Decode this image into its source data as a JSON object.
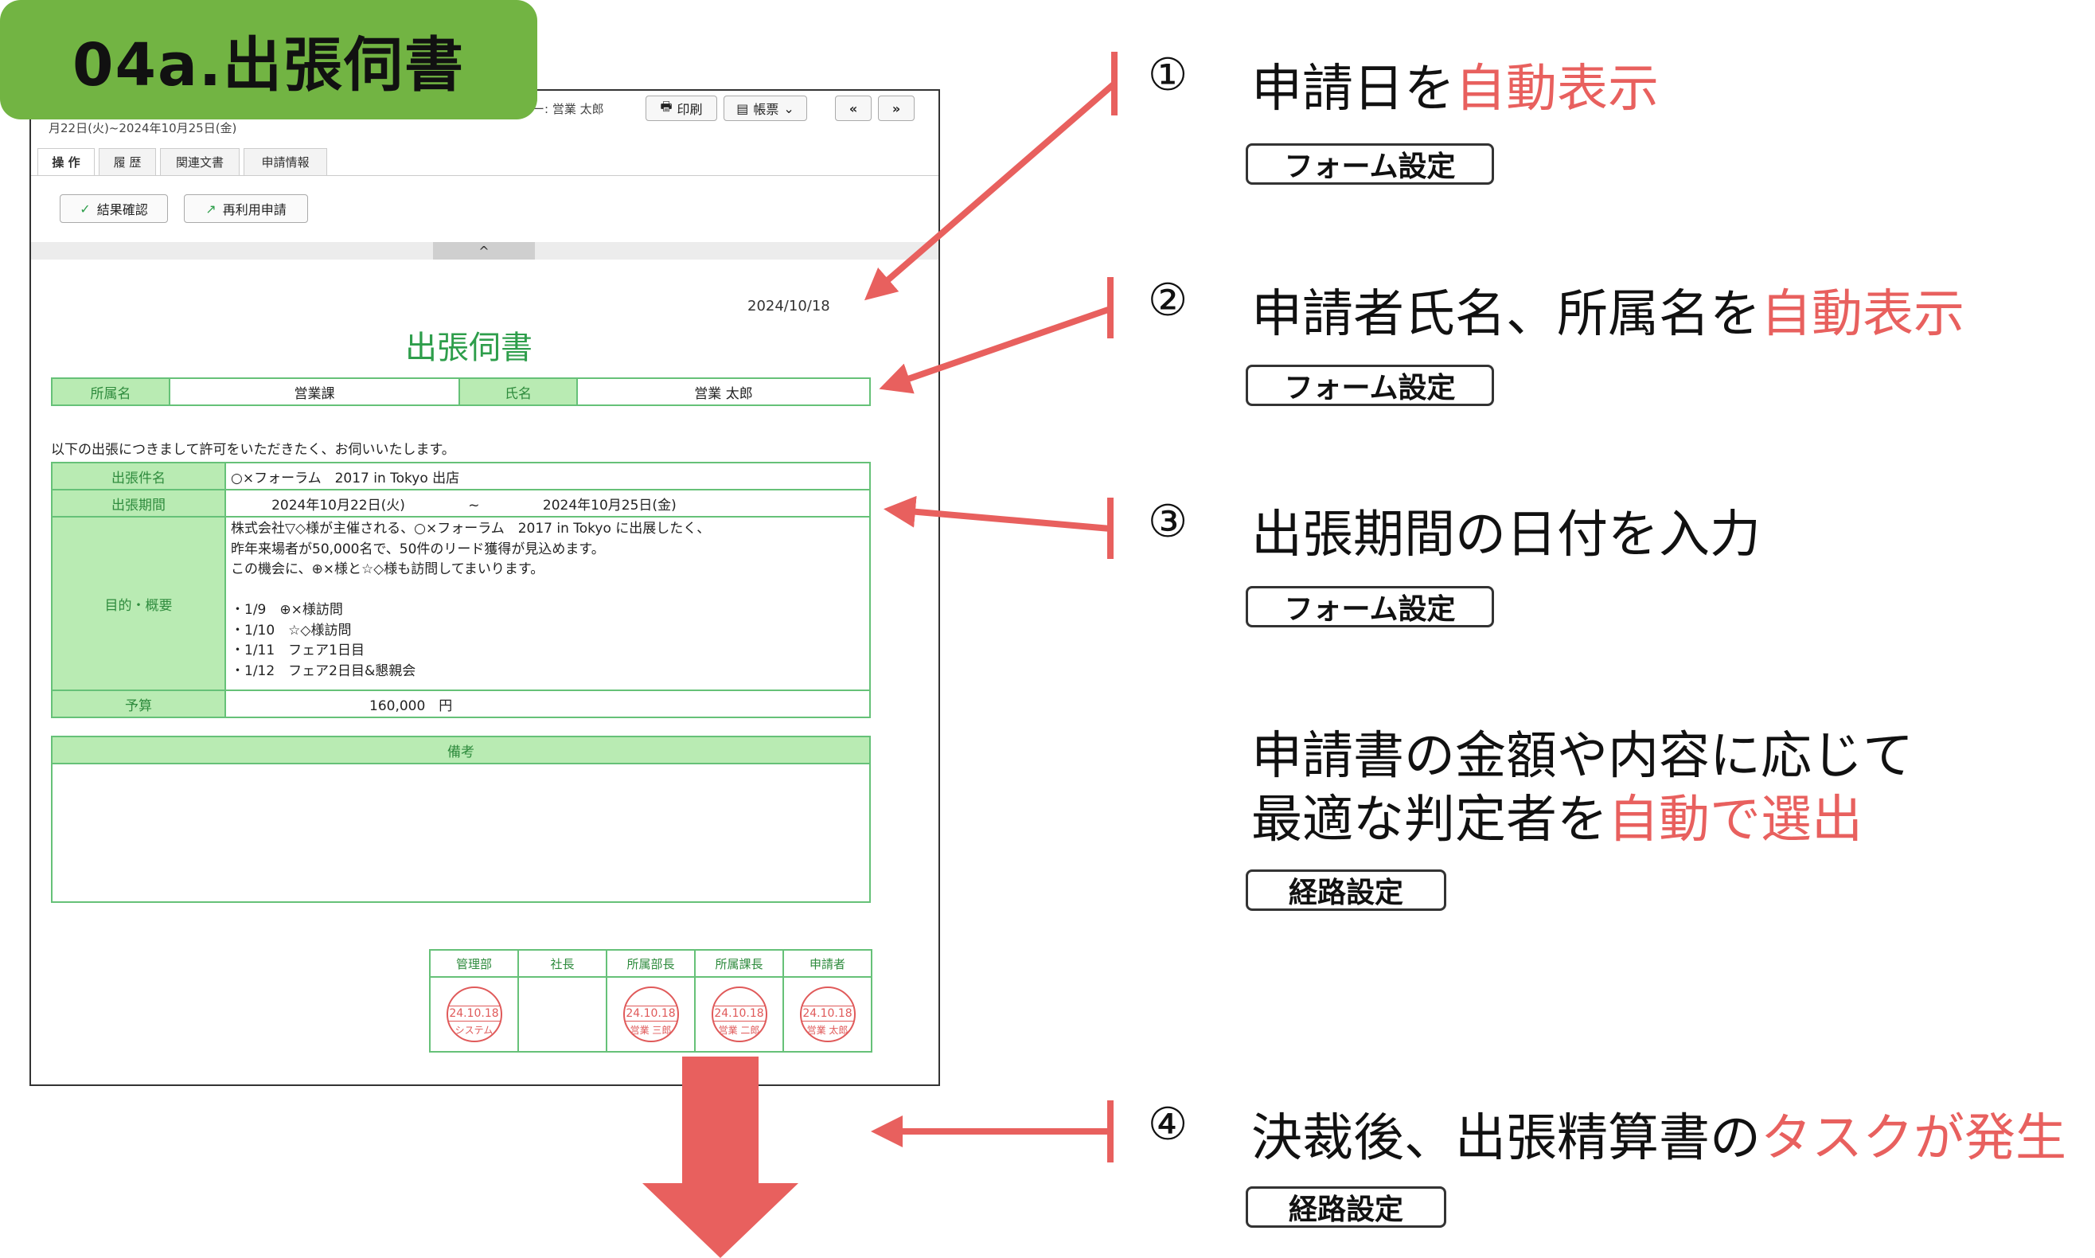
{
  "title": "04a.出張伺書",
  "app": {
    "period_text": "月22日(火)~2024年10月25日(金)",
    "applicant_text": "ー: 営業 太郎",
    "toolbar": {
      "print_label": "印刷",
      "forms_label": "帳票",
      "prev_label": "«",
      "next_label": "»"
    },
    "tabs": [
      "操 作",
      "履 歴",
      "関連文書",
      "申請情報"
    ],
    "actions": {
      "confirm_label": "結果確認",
      "reuse_label": "再利用申請"
    },
    "collapse_label": "^",
    "doc": {
      "date": "2024/10/18",
      "title": "出張伺書",
      "dept_label": "所属名",
      "dept_value": "営業課",
      "name_label": "氏名",
      "name_value": "営業 太郎",
      "intro": "以下の出張につきまして許可をいただきたく、お伺いいたします。",
      "subject_label": "出張件名",
      "subject_value": "○×フォーラム　2017 in Tokyo 出店",
      "period_label": "出張期間",
      "period_start": "2024年10月22日(火)",
      "period_sep": "~",
      "period_end": "2024年10月25日(金)",
      "purpose_label": "目的・概要",
      "purpose_lines": [
        "株式会社▽◇様が主催される、○×フォーラム　2017 in Tokyo に出展したく、",
        "昨年来場者が50,000名で、50件のリード獲得が見込めます。",
        "この機会に、⊕×様と☆◇様も訪問してまいります。",
        "",
        "・1/9　⊕×様訪問",
        "・1/10　☆◇様訪問",
        "・1/11　フェア1日目",
        "・1/12　フェア2日目&懇親会"
      ],
      "budget_label": "予算",
      "budget_value": "160,000　円",
      "remarks_label": "備考",
      "stamps": [
        {
          "role": "管理部",
          "date": "24.10.18",
          "name": "システム"
        },
        {
          "role": "社長",
          "date": "",
          "name": ""
        },
        {
          "role": "所属部長",
          "date": "24.10.18",
          "name": "営業 三郎"
        },
        {
          "role": "所属課長",
          "date": "24.10.18",
          "name": "営業 二郎"
        },
        {
          "role": "申請者",
          "date": "24.10.18",
          "name": "営業 太郎"
        }
      ]
    }
  },
  "annotations": [
    {
      "num": "①",
      "text": "申請日を",
      "highlight": "自動表示",
      "button": "フォーム設定"
    },
    {
      "num": "②",
      "text": "申請者氏名、所属名を",
      "highlight": "自動表示",
      "button": "フォーム設定"
    },
    {
      "num": "③",
      "text": "出張期間の日付を入力",
      "highlight": "",
      "button": "フォーム設定"
    },
    {
      "num": "",
      "line1": "申請書の金額や内容に応じて",
      "text": "最適な判定者を",
      "highlight": "自動で選出",
      "button": "経路設定"
    },
    {
      "num": "④",
      "text": "決裁後、出張精算書の",
      "highlight": "タスクが発生",
      "button": "経路設定"
    }
  ],
  "colors": {
    "accent_green": "#72b443",
    "form_green": "#2e9e4b",
    "highlight_red": "#e8605e",
    "arrow_red": "#e8605e"
  }
}
